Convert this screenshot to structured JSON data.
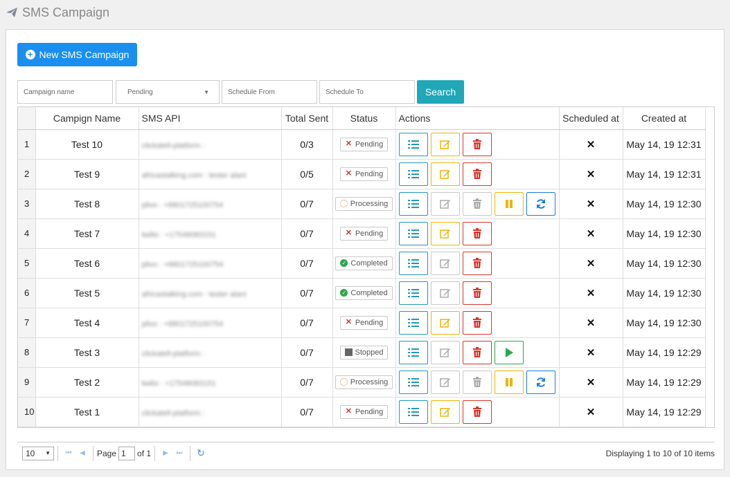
{
  "header": {
    "title": "SMS Campaign",
    "icon": "paper-plane-icon"
  },
  "toolbar": {
    "new_label": "New SMS Campaign",
    "search_label": "Search"
  },
  "filters": {
    "campaign_name_placeholder": "Campaign name",
    "status_value": "Pending",
    "schedule_from_placeholder": "Schedule From",
    "schedule_to_placeholder": "Schedule To"
  },
  "table": {
    "columns": [
      "",
      "Campign Name",
      "SMS API",
      "Total Sent",
      "Status",
      "Actions",
      "Scheduled at",
      "Created at"
    ],
    "rows": [
      {
        "n": "1",
        "name": "Test 10",
        "api": "clickatell-platform : ",
        "sent": "0/3",
        "status": "Pending",
        "status_icon": "x",
        "actions": [
          "list",
          "edit",
          "delete"
        ],
        "sched": "✕",
        "created": "May 14, 19 12:31"
      },
      {
        "n": "2",
        "name": "Test 9",
        "api": "africastalking.com : tester alani",
        "sent": "0/5",
        "status": "Pending",
        "status_icon": "x",
        "actions": [
          "list",
          "edit",
          "delete"
        ],
        "sched": "✕",
        "created": "May 14, 19 12:31"
      },
      {
        "n": "3",
        "name": "Test 8",
        "api": "plivo : +8801725100754",
        "sent": "0/7",
        "status": "Processing",
        "status_icon": "proc",
        "actions": [
          "list",
          "edit-disabled",
          "delete-disabled",
          "pause",
          "sync"
        ],
        "sched": "✕",
        "created": "May 14, 19 12:30"
      },
      {
        "n": "4",
        "name": "Test 7",
        "api": "twilio : +17548083151",
        "sent": "0/7",
        "status": "Pending",
        "status_icon": "x",
        "actions": [
          "list",
          "edit",
          "delete"
        ],
        "sched": "✕",
        "created": "May 14, 19 12:30"
      },
      {
        "n": "5",
        "name": "Test 6",
        "api": "plivo : +8801725100754",
        "sent": "0/7",
        "status": "Completed",
        "status_icon": "ok",
        "actions": [
          "list",
          "edit-disabled",
          "delete"
        ],
        "sched": "✕",
        "created": "May 14, 19 12:30"
      },
      {
        "n": "6",
        "name": "Test 5",
        "api": "africastalking.com : tester alani",
        "sent": "0/7",
        "status": "Completed",
        "status_icon": "ok",
        "actions": [
          "list",
          "edit-disabled",
          "delete"
        ],
        "sched": "✕",
        "created": "May 14, 19 12:30"
      },
      {
        "n": "7",
        "name": "Test 4",
        "api": "plivo : +8801725100754",
        "sent": "0/7",
        "status": "Pending",
        "status_icon": "x",
        "actions": [
          "list",
          "edit",
          "delete"
        ],
        "sched": "✕",
        "created": "May 14, 19 12:30"
      },
      {
        "n": "8",
        "name": "Test 3",
        "api": "clickatell-platform : ",
        "sent": "0/7",
        "status": "Stopped",
        "status_icon": "stop",
        "actions": [
          "list",
          "edit-disabled",
          "delete",
          "play"
        ],
        "sched": "✕",
        "created": "May 14, 19 12:29"
      },
      {
        "n": "9",
        "name": "Test 2",
        "api": "twilio : +17548083151",
        "sent": "0/7",
        "status": "Processing",
        "status_icon": "proc",
        "actions": [
          "list",
          "edit-disabled",
          "delete-disabled",
          "pause",
          "sync"
        ],
        "sched": "✕",
        "created": "May 14, 19 12:29"
      },
      {
        "n": "10",
        "name": "Test 1",
        "api": "clickatell-platform : ",
        "sent": "0/7",
        "status": "Pending",
        "status_icon": "x",
        "actions": [
          "list",
          "edit",
          "delete"
        ],
        "sched": "✕",
        "created": "May 14, 19 12:29"
      }
    ]
  },
  "pager": {
    "page_size": "10",
    "page_label": "Page",
    "page_value": "1",
    "of_label": "of 1",
    "display": "Displaying 1 to 10 of 10 items"
  },
  "colors": {
    "primary": "#1b8ff0",
    "search": "#20a7b8",
    "list": "#2098b8",
    "edit": "#f0b400",
    "delete": "#d9342b",
    "sync": "#1a7fd8",
    "play": "#2aa84a"
  }
}
